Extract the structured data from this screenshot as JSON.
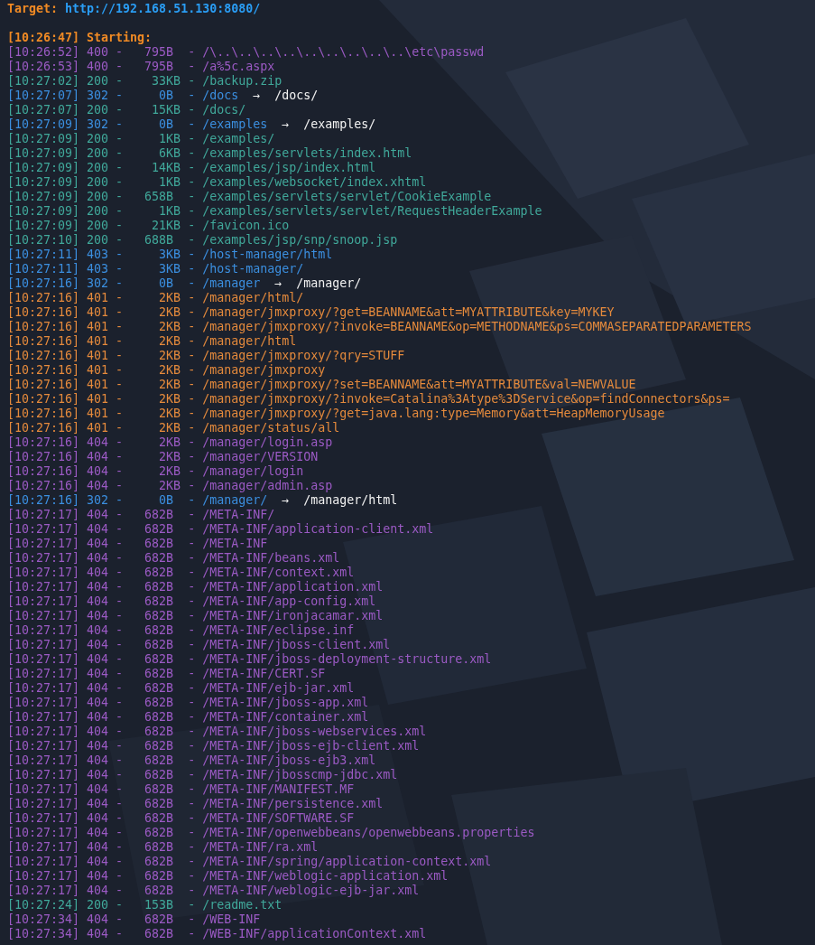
{
  "target": {
    "label": "Target:",
    "url": "http://192.168.51.130:8080/"
  },
  "start": {
    "time": "[10:26:47]",
    "text": "Starting:"
  },
  "lines": [
    {
      "text": "[10:26:52] 400 -   795B  - /\\..\\..\\..\\..\\..\\..\\..\\..\\..\\etc\\passwd",
      "color": "#9b5ac4"
    },
    {
      "text": "[10:26:53] 400 -   795B  - /a%5c.aspx",
      "color": "#9b5ac4"
    },
    {
      "text": "[10:27:02] 200 -    33KB - /backup.zip",
      "color": "#40a89a"
    },
    {
      "text": "[10:27:07] 302 -     0B  - /docs",
      "color": "#3b8fe0",
      "arrow": "→",
      "redirect": "/docs/"
    },
    {
      "text": "[10:27:07] 200 -    15KB - /docs/",
      "color": "#40a89a"
    },
    {
      "text": "[10:27:09] 302 -     0B  - /examples",
      "color": "#3b8fe0",
      "arrow": "→",
      "redirect": "/examples/"
    },
    {
      "text": "[10:27:09] 200 -     1KB - /examples/",
      "color": "#40a89a"
    },
    {
      "text": "[10:27:09] 200 -     6KB - /examples/servlets/index.html",
      "color": "#40a89a"
    },
    {
      "text": "[10:27:09] 200 -    14KB - /examples/jsp/index.html",
      "color": "#40a89a"
    },
    {
      "text": "[10:27:09] 200 -     1KB - /examples/websocket/index.xhtml",
      "color": "#40a89a"
    },
    {
      "text": "[10:27:09] 200 -   658B  - /examples/servlets/servlet/CookieExample",
      "color": "#40a89a"
    },
    {
      "text": "[10:27:09] 200 -     1KB - /examples/servlets/servlet/RequestHeaderExample",
      "color": "#40a89a"
    },
    {
      "text": "[10:27:09] 200 -    21KB - /favicon.ico",
      "color": "#40a89a"
    },
    {
      "text": "[10:27:10] 200 -   688B  - /examples/jsp/snp/snoop.jsp",
      "color": "#40a89a"
    },
    {
      "text": "[10:27:11] 403 -     3KB - /host-manager/html",
      "color": "#3b8fe0"
    },
    {
      "text": "[10:27:11] 403 -     3KB - /host-manager/",
      "color": "#3b8fe0"
    },
    {
      "text": "[10:27:16] 302 -     0B  - /manager",
      "color": "#3b8fe0",
      "arrow": "→",
      "redirect": "/manager/"
    },
    {
      "text": "[10:27:16] 401 -     2KB - /manager/html/",
      "color": "#e58a3c"
    },
    {
      "text": "[10:27:16] 401 -     2KB - /manager/jmxproxy/?get=BEANNAME&att=MYATTRIBUTE&key=MYKEY",
      "color": "#e58a3c"
    },
    {
      "text": "[10:27:16] 401 -     2KB - /manager/jmxproxy/?invoke=BEANNAME&op=METHODNAME&ps=COMMASEPARATEDPARAMETERS",
      "color": "#e58a3c"
    },
    {
      "text": "[10:27:16] 401 -     2KB - /manager/html",
      "color": "#e58a3c"
    },
    {
      "text": "[10:27:16] 401 -     2KB - /manager/jmxproxy/?qry=STUFF",
      "color": "#e58a3c"
    },
    {
      "text": "[10:27:16] 401 -     2KB - /manager/jmxproxy",
      "color": "#e58a3c"
    },
    {
      "text": "[10:27:16] 401 -     2KB - /manager/jmxproxy/?set=BEANNAME&att=MYATTRIBUTE&val=NEWVALUE",
      "color": "#e58a3c"
    },
    {
      "text": "[10:27:16] 401 -     2KB - /manager/jmxproxy/?invoke=Catalina%3Atype%3DService&op=findConnectors&ps=",
      "color": "#e58a3c"
    },
    {
      "text": "[10:27:16] 401 -     2KB - /manager/jmxproxy/?get=java.lang:type=Memory&att=HeapMemoryUsage",
      "color": "#e58a3c"
    },
    {
      "text": "[10:27:16] 401 -     2KB - /manager/status/all",
      "color": "#e58a3c"
    },
    {
      "text": "[10:27:16] 404 -     2KB - /manager/login.asp",
      "color": "#9b5ac4"
    },
    {
      "text": "[10:27:16] 404 -     2KB - /manager/VERSION",
      "color": "#9b5ac4"
    },
    {
      "text": "[10:27:16] 404 -     2KB - /manager/login",
      "color": "#9b5ac4"
    },
    {
      "text": "[10:27:16] 404 -     2KB - /manager/admin.asp",
      "color": "#9b5ac4"
    },
    {
      "text": "[10:27:16] 302 -     0B  - /manager/",
      "color": "#3b8fe0",
      "arrow": "→",
      "redirect": "/manager/html"
    },
    {
      "text": "[10:27:17] 404 -   682B  - /META-INF/",
      "color": "#9b5ac4"
    },
    {
      "text": "[10:27:17] 404 -   682B  - /META-INF/application-client.xml",
      "color": "#9b5ac4"
    },
    {
      "text": "[10:27:17] 404 -   682B  - /META-INF",
      "color": "#9b5ac4"
    },
    {
      "text": "[10:27:17] 404 -   682B  - /META-INF/beans.xml",
      "color": "#9b5ac4"
    },
    {
      "text": "[10:27:17] 404 -   682B  - /META-INF/context.xml",
      "color": "#9b5ac4"
    },
    {
      "text": "[10:27:17] 404 -   682B  - /META-INF/application.xml",
      "color": "#9b5ac4"
    },
    {
      "text": "[10:27:17] 404 -   682B  - /META-INF/app-config.xml",
      "color": "#9b5ac4"
    },
    {
      "text": "[10:27:17] 404 -   682B  - /META-INF/ironjacamar.xml",
      "color": "#9b5ac4"
    },
    {
      "text": "[10:27:17] 404 -   682B  - /META-INF/eclipse.inf",
      "color": "#9b5ac4"
    },
    {
      "text": "[10:27:17] 404 -   682B  - /META-INF/jboss-client.xml",
      "color": "#9b5ac4"
    },
    {
      "text": "[10:27:17] 404 -   682B  - /META-INF/jboss-deployment-structure.xml",
      "color": "#9b5ac4"
    },
    {
      "text": "[10:27:17] 404 -   682B  - /META-INF/CERT.SF",
      "color": "#9b5ac4"
    },
    {
      "text": "[10:27:17] 404 -   682B  - /META-INF/ejb-jar.xml",
      "color": "#9b5ac4"
    },
    {
      "text": "[10:27:17] 404 -   682B  - /META-INF/jboss-app.xml",
      "color": "#9b5ac4"
    },
    {
      "text": "[10:27:17] 404 -   682B  - /META-INF/container.xml",
      "color": "#9b5ac4"
    },
    {
      "text": "[10:27:17] 404 -   682B  - /META-INF/jboss-webservices.xml",
      "color": "#9b5ac4"
    },
    {
      "text": "[10:27:17] 404 -   682B  - /META-INF/jboss-ejb-client.xml",
      "color": "#9b5ac4"
    },
    {
      "text": "[10:27:17] 404 -   682B  - /META-INF/jboss-ejb3.xml",
      "color": "#9b5ac4"
    },
    {
      "text": "[10:27:17] 404 -   682B  - /META-INF/jbosscmp-jdbc.xml",
      "color": "#9b5ac4"
    },
    {
      "text": "[10:27:17] 404 -   682B  - /META-INF/MANIFEST.MF",
      "color": "#9b5ac4"
    },
    {
      "text": "[10:27:17] 404 -   682B  - /META-INF/persistence.xml",
      "color": "#9b5ac4"
    },
    {
      "text": "[10:27:17] 404 -   682B  - /META-INF/SOFTWARE.SF",
      "color": "#9b5ac4"
    },
    {
      "text": "[10:27:17] 404 -   682B  - /META-INF/openwebbeans/openwebbeans.properties",
      "color": "#9b5ac4"
    },
    {
      "text": "[10:27:17] 404 -   682B  - /META-INF/ra.xml",
      "color": "#9b5ac4"
    },
    {
      "text": "[10:27:17] 404 -   682B  - /META-INF/spring/application-context.xml",
      "color": "#9b5ac4"
    },
    {
      "text": "[10:27:17] 404 -   682B  - /META-INF/weblogic-application.xml",
      "color": "#9b5ac4"
    },
    {
      "text": "[10:27:17] 404 -   682B  - /META-INF/weblogic-ejb-jar.xml",
      "color": "#9b5ac4"
    },
    {
      "text": "[10:27:24] 200 -   153B  - /readme.txt",
      "color": "#40a89a"
    },
    {
      "text": "[10:27:34] 404 -   682B  - /WEB-INF",
      "color": "#9b5ac4"
    },
    {
      "text": "[10:27:34] 404 -   682B  - /WEB-INF/applicationContext.xml",
      "color": "#9b5ac4"
    }
  ]
}
